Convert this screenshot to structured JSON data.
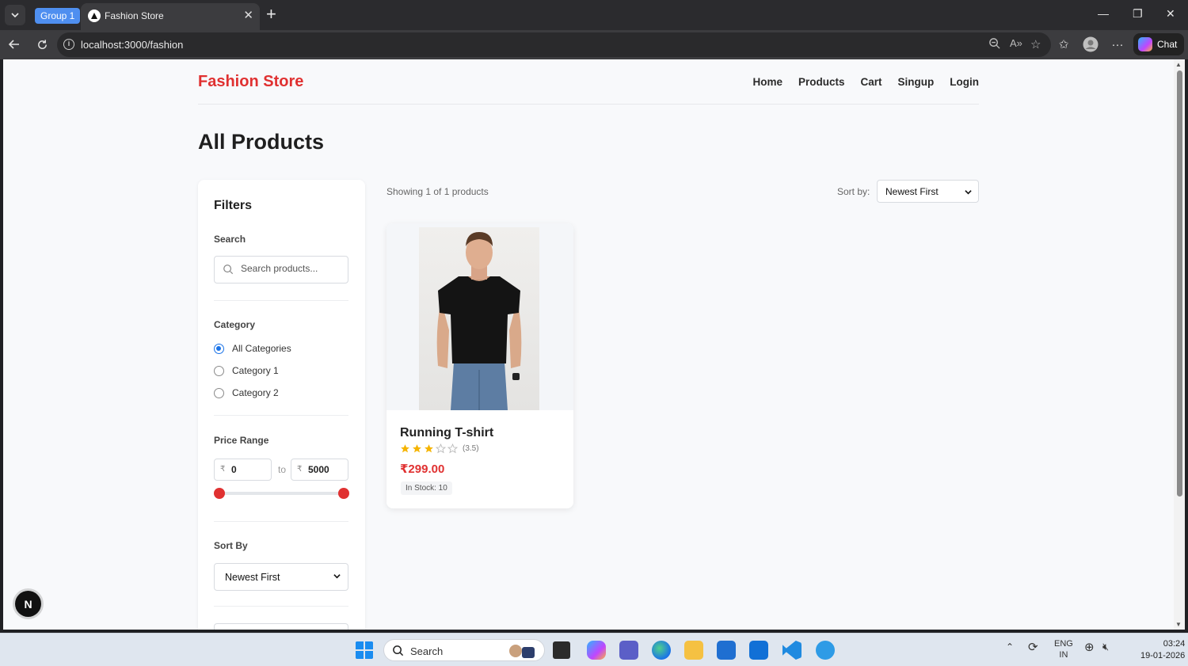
{
  "browser": {
    "group_label": "Group 1",
    "tab_title": "Fashion Store",
    "url": "localhost:3000/fashion",
    "chat_label": "Chat"
  },
  "site": {
    "brand": "Fashion Store",
    "nav": [
      "Home",
      "Products",
      "Cart",
      "Singup",
      "Login"
    ],
    "brand_color": "#e03131"
  },
  "page": {
    "title": "All Products",
    "showing_text": "Showing 1 of 1 products",
    "sort_label": "Sort by:",
    "sort_value": "Newest First"
  },
  "filters": {
    "title": "Filters",
    "search_label": "Search",
    "search_placeholder": "Search products...",
    "category_label": "Category",
    "categories": [
      {
        "label": "All Categories",
        "checked": true
      },
      {
        "label": "Category 1",
        "checked": false
      },
      {
        "label": "Category 2",
        "checked": false
      }
    ],
    "price_label": "Price Range",
    "currency": "₹",
    "price_min": "0",
    "price_max": "5000",
    "price_to": "to",
    "sortby_label": "Sort By",
    "sortby_value": "Newest First"
  },
  "product": {
    "name": "Running T-shirt",
    "rating": 3.5,
    "rating_text": "(3.5)",
    "price": "₹299.00",
    "stock": "In Stock: 10"
  },
  "next_badge": "N",
  "taskbar": {
    "search_text": "Search",
    "lang_top": "ENG",
    "lang_bottom": "IN",
    "time": "03:24",
    "date": "19-01-2026"
  }
}
